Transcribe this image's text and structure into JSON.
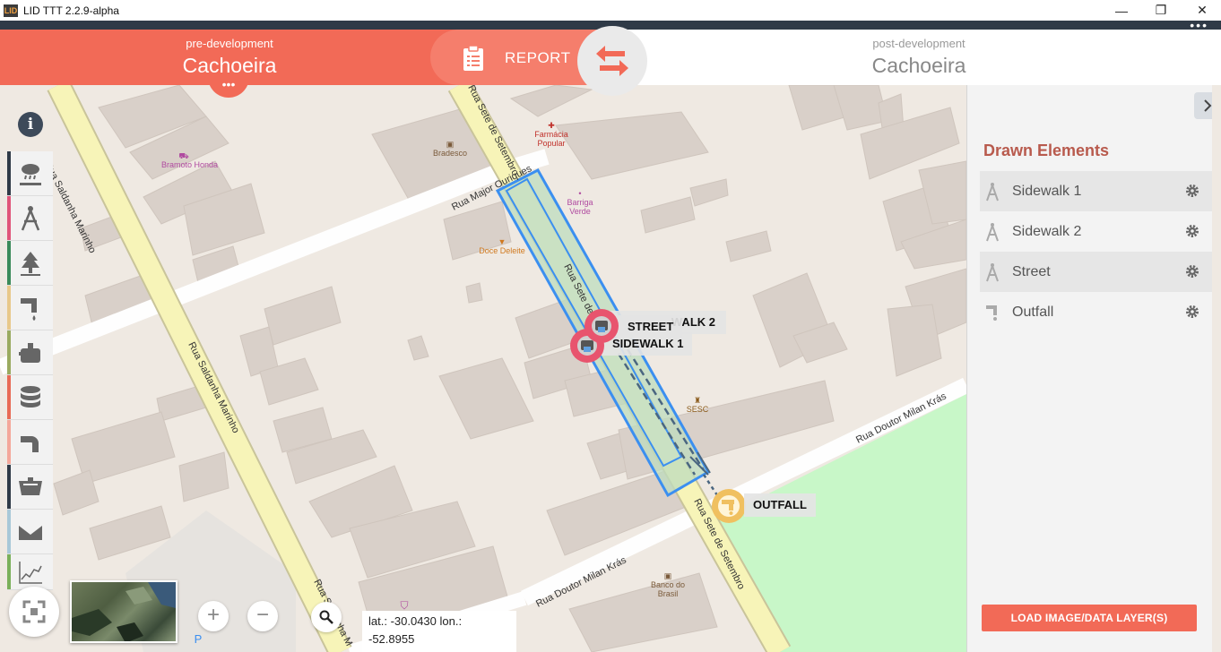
{
  "window": {
    "title": "LID TTT 2.2.9-alpha",
    "icon_text": "LID",
    "minimize": "—",
    "maximize": "❐",
    "close": "✕",
    "more": "•••"
  },
  "header": {
    "pre": {
      "subtitle": "pre-development",
      "name": "Cachoeira",
      "more": "•••"
    },
    "report_label": "REPORT",
    "post": {
      "subtitle": "post-development",
      "name": "Cachoeira"
    }
  },
  "map": {
    "streets": [
      "Rua Saldanha Marinho",
      "Rua Saldanha Marinho",
      "Rua Saldanha M",
      "Rua Major Ouriques",
      "Rua Sete de Setembro",
      "Rua Sete de Setembro",
      "Rua Sete de",
      "Rua Doutor Milan Krás",
      "Rua Doutor Milan Krás"
    ],
    "pois": [
      {
        "name": "Bramoto Honda",
        "color": "#b04aa0"
      },
      {
        "name": "Bradesco",
        "color": "#7a5a3a"
      },
      {
        "name": "Farmácia Popular",
        "color": "#c0302a"
      },
      {
        "name": "Barriga Verde",
        "color": "#b04aa0"
      },
      {
        "name": "Doce Deleite",
        "color": "#d07a20"
      },
      {
        "name": "SESC",
        "color": "#8a5a1a"
      },
      {
        "name": "Banco do Brasil",
        "color": "#7a5a3a"
      }
    ],
    "tags": {
      "street": "STREET",
      "sidewalk2": "WALK 2",
      "sidewalk1": "SIDEWALK 1",
      "outfall": "OUTFALL"
    },
    "info_icon": "i",
    "zoom_in": "+",
    "zoom_out": "−",
    "coords_line1": "lat.: -30.0430 lon.:",
    "coords_line2": "-52.8955",
    "parking": "P"
  },
  "toolbar": [
    {
      "name": "rain-tool",
      "stripe": "#2f3a47"
    },
    {
      "name": "drawing-compass-tool",
      "stripe": "#e0557a"
    },
    {
      "name": "tree-tool",
      "stripe": "#3a8a5a"
    },
    {
      "name": "downspout-tool",
      "stripe": "#e8c88a"
    },
    {
      "name": "rain-barrel-tool",
      "stripe": "#9aaa60"
    },
    {
      "name": "cistern-tool",
      "stripe": "#e86a55"
    },
    {
      "name": "pipe-tool",
      "stripe": "#f4a79a"
    },
    {
      "name": "basin-tool",
      "stripe": "#2f3a47"
    },
    {
      "name": "swale-tool",
      "stripe": "#a8c8d8"
    },
    {
      "name": "chart-tool",
      "stripe": "#7ab05a"
    }
  ],
  "panel": {
    "title": "Drawn Elements",
    "elements": [
      {
        "label": "Sidewalk 1",
        "icon": "compass-icon"
      },
      {
        "label": "Sidewalk 2",
        "icon": "compass-icon"
      },
      {
        "label": "Street",
        "icon": "compass-icon"
      },
      {
        "label": "Outfall",
        "icon": "downspout-icon"
      }
    ],
    "load_button": "LOAD IMAGE/DATA LAYER(S)"
  },
  "colors": {
    "accent": "#f26a57",
    "polygon": "#3b8ff0",
    "marker": "#e8546e",
    "outfall": "#f0c060",
    "park": "#c8f7c8"
  }
}
